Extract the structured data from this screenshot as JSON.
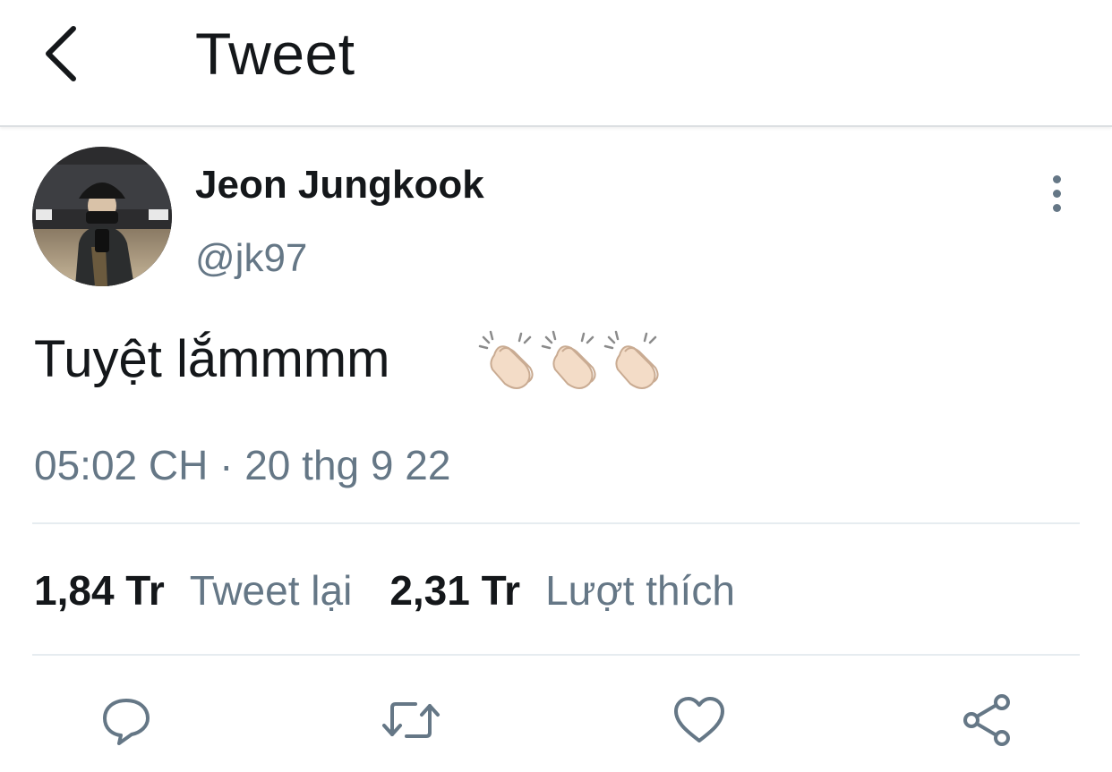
{
  "header": {
    "back_icon": "chevron-left-icon",
    "title": "Tweet"
  },
  "author": {
    "display_name": "Jeon Jungkook",
    "handle": "@jk97"
  },
  "tweet": {
    "text": "Tuyệt lắmmmm",
    "emoji_icon": "clapping-hands-icon",
    "emoji_count": 3,
    "timestamp": "05:02 CH · 20 thg 9 22"
  },
  "stats": {
    "retweets_count": "1,84 Tr",
    "retweets_label": "Tweet lại",
    "likes_count": "2,31 Tr",
    "likes_label": "Lượt thích"
  },
  "actions": [
    "reply-icon",
    "retweet-icon",
    "like-icon",
    "share-icon"
  ],
  "colors": {
    "text_primary": "#14171a",
    "text_secondary": "#657786",
    "divider": "#e6ecf0",
    "emoji_skin": "#f3dcc7"
  }
}
